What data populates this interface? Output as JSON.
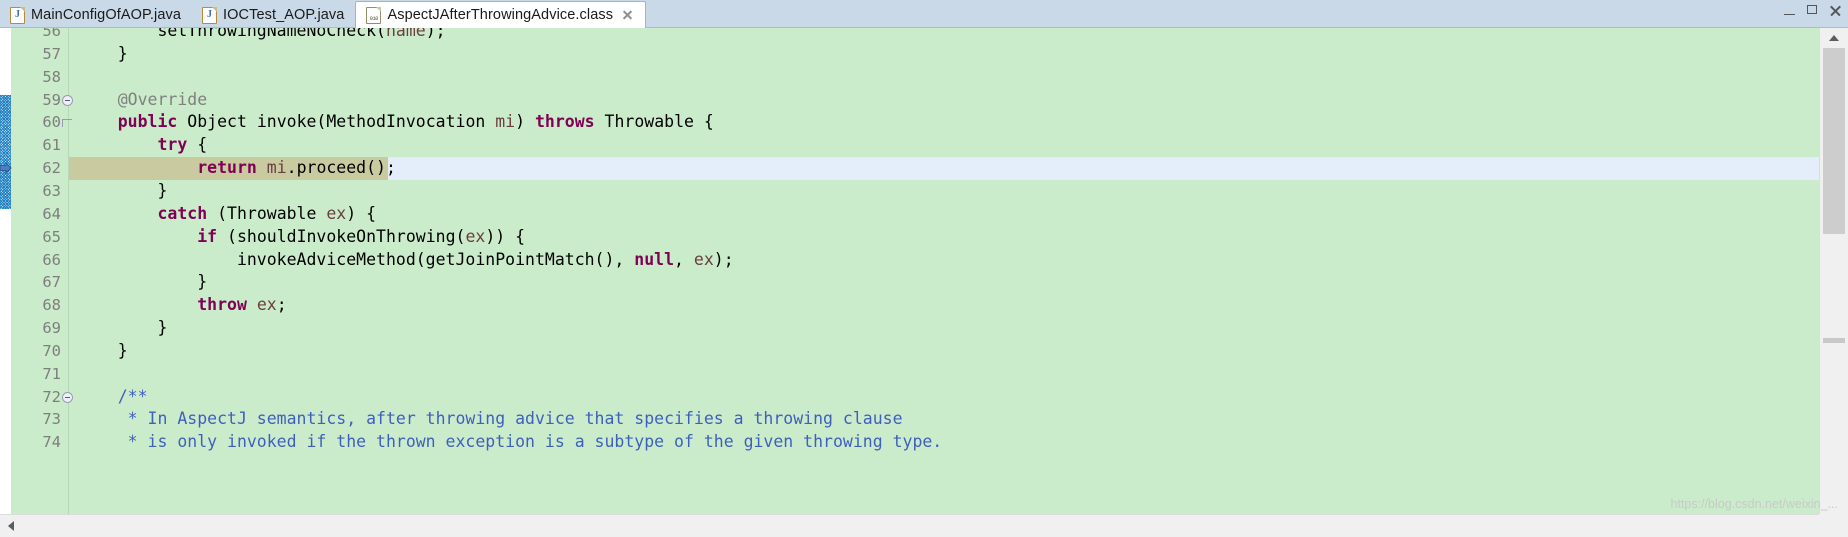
{
  "window": {
    "controls": [
      {
        "name": "minimize",
        "glyph": "minimize-icon"
      },
      {
        "name": "maximize",
        "glyph": "maximize-icon"
      },
      {
        "name": "close",
        "glyph": "close-icon"
      }
    ]
  },
  "tabbar": {
    "tabs": [
      {
        "label": "MainConfigOfAOP.java",
        "icon": "java-file-icon",
        "active": false,
        "closable": false
      },
      {
        "label": "IOCTest_AOP.java",
        "icon": "java-file-icon",
        "active": false,
        "closable": false
      },
      {
        "label": "AspectJAfterThrowingAdvice.class",
        "icon": "class-file-icon",
        "active": true,
        "closable": true
      }
    ]
  },
  "editor": {
    "background_color": "#cbeccb",
    "current_line_color": "#e4eefb",
    "occurrence_color": "#c9caa0",
    "keyword_color": "#7f0055",
    "field_color": "#6a3e3e",
    "annotation_color": "#808080",
    "javadoc_color": "#3f5fbf",
    "first_visible_line": 56,
    "caret_line": 62,
    "lines": [
      {
        "n": "56",
        "text": "        setThrowingNameNoCheck(name);",
        "clipped": true
      },
      {
        "n": "57",
        "text": "    }"
      },
      {
        "n": "58",
        "text": ""
      },
      {
        "n": "59",
        "text": "    @Override",
        "fold": "collapsible"
      },
      {
        "n": "60",
        "text": "    public Object invoke(MethodInvocation mi) throws Throwable {",
        "fold": "fold-end"
      },
      {
        "n": "61",
        "text": "        try {"
      },
      {
        "n": "62",
        "text": "            return mi.proceed();",
        "marker": "breakpoint-arrow-icon",
        "highlight": true
      },
      {
        "n": "63",
        "text": "        }"
      },
      {
        "n": "64",
        "text": "        catch (Throwable ex) {"
      },
      {
        "n": "65",
        "text": "            if (shouldInvokeOnThrowing(ex)) {"
      },
      {
        "n": "66",
        "text": "                invokeAdviceMethod(getJoinPointMatch(), null, ex);"
      },
      {
        "n": "67",
        "text": "            }"
      },
      {
        "n": "68",
        "text": "            throw ex;"
      },
      {
        "n": "69",
        "text": "        }"
      },
      {
        "n": "70",
        "text": "    }"
      },
      {
        "n": "71",
        "text": ""
      },
      {
        "n": "72",
        "text": "    /**",
        "fold": "collapsible"
      },
      {
        "n": "73",
        "text": "     * In AspectJ semantics, after throwing advice that specifies a throwing clause"
      },
      {
        "n": "74",
        "text": "     * is only invoked if the thrown exception is a subtype of the given throwing type.",
        "clipped": true
      }
    ]
  },
  "scrollbars": {
    "vertical": {
      "up_icon": "scroll-up-arrow-icon",
      "down_icon": "scroll-down-arrow-icon"
    },
    "horizontal": {
      "left_icon": "scroll-left-arrow-icon"
    }
  },
  "watermark": {
    "text": "https://blog.csdn.net/weixin_..."
  }
}
